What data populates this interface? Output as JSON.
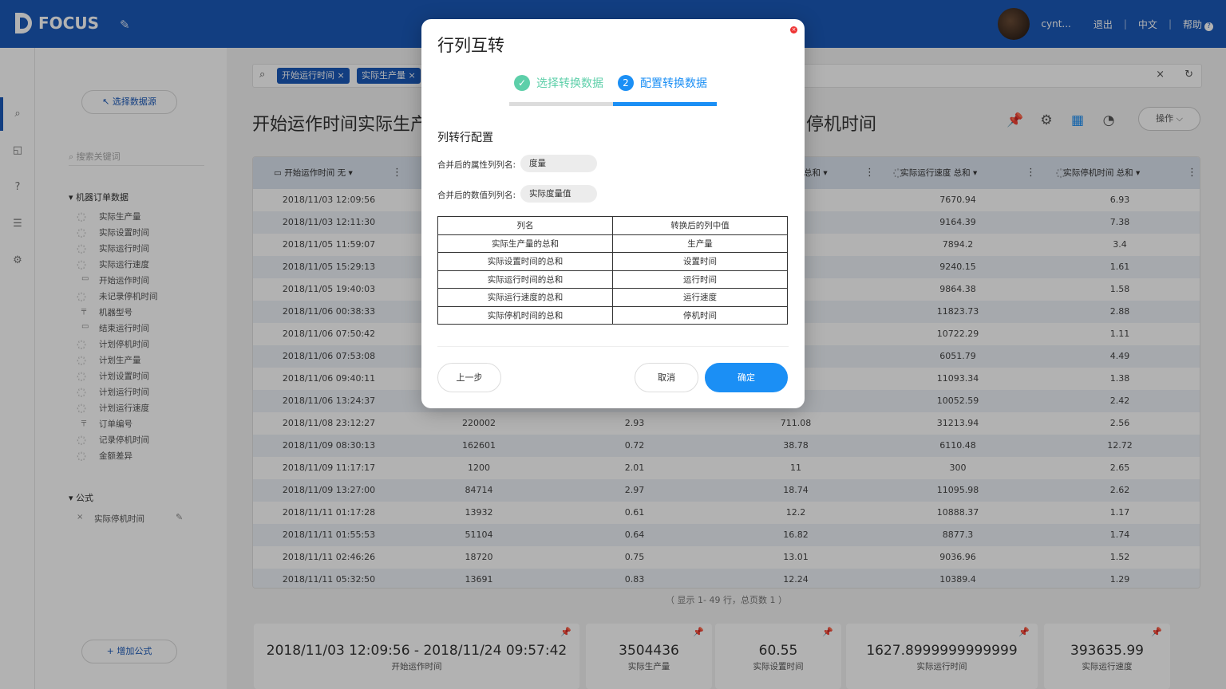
{
  "app": {
    "logo_text": "FOCUS"
  },
  "topbar": {
    "username": "cynt...",
    "logout": "退出",
    "language": "中文",
    "help": "帮助"
  },
  "sidebar": {
    "select_source_button": "↖ 选择数据源",
    "search_placeholder": "搜索关键词",
    "group_title": "机器订单数据",
    "fields": [
      {
        "icon": "measure-icon",
        "label": "实际生产量"
      },
      {
        "icon": "measure-icon",
        "label": "实际设置时间"
      },
      {
        "icon": "measure-icon",
        "label": "实际运行时间"
      },
      {
        "icon": "measure-icon",
        "label": "实际运行速度"
      },
      {
        "icon": "calendar-icon",
        "label": "开始运作时间"
      },
      {
        "icon": "measure-icon",
        "label": "未记录停机时间"
      },
      {
        "icon": "attribute-icon",
        "label": "机器型号"
      },
      {
        "icon": "calendar-icon",
        "label": "结束运行时间"
      },
      {
        "icon": "measure-icon",
        "label": "计划停机时间"
      },
      {
        "icon": "measure-icon",
        "label": "计划生产量"
      },
      {
        "icon": "measure-icon",
        "label": "计划设置时间"
      },
      {
        "icon": "measure-icon",
        "label": "计划运行时间"
      },
      {
        "icon": "measure-icon",
        "label": "计划运行速度"
      },
      {
        "icon": "attribute-icon",
        "label": "订单编号"
      },
      {
        "icon": "measure-icon",
        "label": "记录停机时间"
      },
      {
        "icon": "measure-icon",
        "label": "金额差异"
      }
    ],
    "formula_title": "公式",
    "formula_item": "实际停机时间",
    "add_formula_button": "+ 增加公式"
  },
  "search": {
    "chips": [
      "开始运行时间 ×",
      "实际生产量 ×"
    ]
  },
  "page": {
    "title_left": "开始运作时间实际生产",
    "title_right": "停机时间",
    "ops_button": "操作 ⌵"
  },
  "grid": {
    "headers": [
      "开始运作时间 无",
      "总和",
      "实际运行速度 总和",
      "实际停机时间 总和"
    ],
    "rows": [
      [
        "2018/11/03 12:09:56",
        "",
        "",
        "",
        "7670.94",
        "6.93"
      ],
      [
        "2018/11/03 12:11:30",
        "",
        "",
        "9",
        "9164.39",
        "7.38"
      ],
      [
        "2018/11/05 11:59:07",
        "",
        "",
        "",
        "7894.2",
        "3.4"
      ],
      [
        "2018/11/05 15:29:13",
        "",
        "",
        "3",
        "9240.15",
        "1.61"
      ],
      [
        "2018/11/05 19:40:03",
        "",
        "",
        "9",
        "9864.38",
        "1.58"
      ],
      [
        "2018/11/06 00:38:33",
        "",
        "",
        "9",
        "11823.73",
        "2.88"
      ],
      [
        "2018/11/06 07:50:42",
        "",
        "",
        "4",
        "10722.29",
        "1.11"
      ],
      [
        "2018/11/06 07:53:08",
        "",
        "",
        "3",
        "6051.79",
        "4.49"
      ],
      [
        "2018/11/06 09:40:11",
        "",
        "",
        "",
        "11093.34",
        "1.38"
      ],
      [
        "2018/11/06 13:24:37",
        "",
        "",
        "",
        "10052.59",
        "2.42"
      ],
      [
        "2018/11/08 23:12:27",
        "220002",
        "2.93",
        "711.08",
        "31213.94",
        "2.56"
      ],
      [
        "2018/11/09 08:30:13",
        "162601",
        "0.72",
        "38.78",
        "6110.48",
        "12.72"
      ],
      [
        "2018/11/09 11:17:17",
        "1200",
        "2.01",
        "11",
        "300",
        "2.65"
      ],
      [
        "2018/11/09 13:27:00",
        "84714",
        "2.97",
        "18.74",
        "11095.98",
        "2.62"
      ],
      [
        "2018/11/11 01:17:28",
        "13932",
        "0.61",
        "12.2",
        "10888.37",
        "1.17"
      ],
      [
        "2018/11/11 01:55:53",
        "51104",
        "0.64",
        "16.82",
        "8877.3",
        "1.74"
      ],
      [
        "2018/11/11 02:46:26",
        "18720",
        "0.75",
        "13.01",
        "9036.96",
        "1.52"
      ],
      [
        "2018/11/11 05:32:50",
        "13691",
        "0.83",
        "12.24",
        "10389.4",
        "1.29"
      ]
    ],
    "pager": "（ 显示 1- 49 行，总页数 1 ）"
  },
  "cards": [
    {
      "value": "2018/11/03 12:09:56 - 2018/11/24 09:57:42",
      "label": "开始运作时间"
    },
    {
      "value": "3504436",
      "label": "实际生产量"
    },
    {
      "value": "60.55",
      "label": "实际设置时间"
    },
    {
      "value": "1627.8999999999999",
      "label": "实际运行时间"
    },
    {
      "value": "393635.99",
      "label": "实际运行速度"
    }
  ],
  "modal": {
    "title": "行列互转",
    "step1": "选择转换数据",
    "step2_num": "2",
    "step2": "配置转换数据",
    "section": "列转行配置",
    "attr_label": "合并后的属性列列名:",
    "attr_value": "度量",
    "value_label": "合并后的数值列列名:",
    "value_value": "实际度量值",
    "table_headers": [
      "列名",
      "转换后的列中值"
    ],
    "table_rows": [
      [
        "实际生产量的总和",
        "生产量"
      ],
      [
        "实际设置时间的总和",
        "设置时间"
      ],
      [
        "实际运行时间的总和",
        "运行时间"
      ],
      [
        "实际运行速度的总和",
        "运行速度"
      ],
      [
        "实际停机时间的总和",
        "停机时间"
      ]
    ],
    "prev_button": "上一步",
    "cancel_button": "取消",
    "confirm_button": "确定"
  }
}
